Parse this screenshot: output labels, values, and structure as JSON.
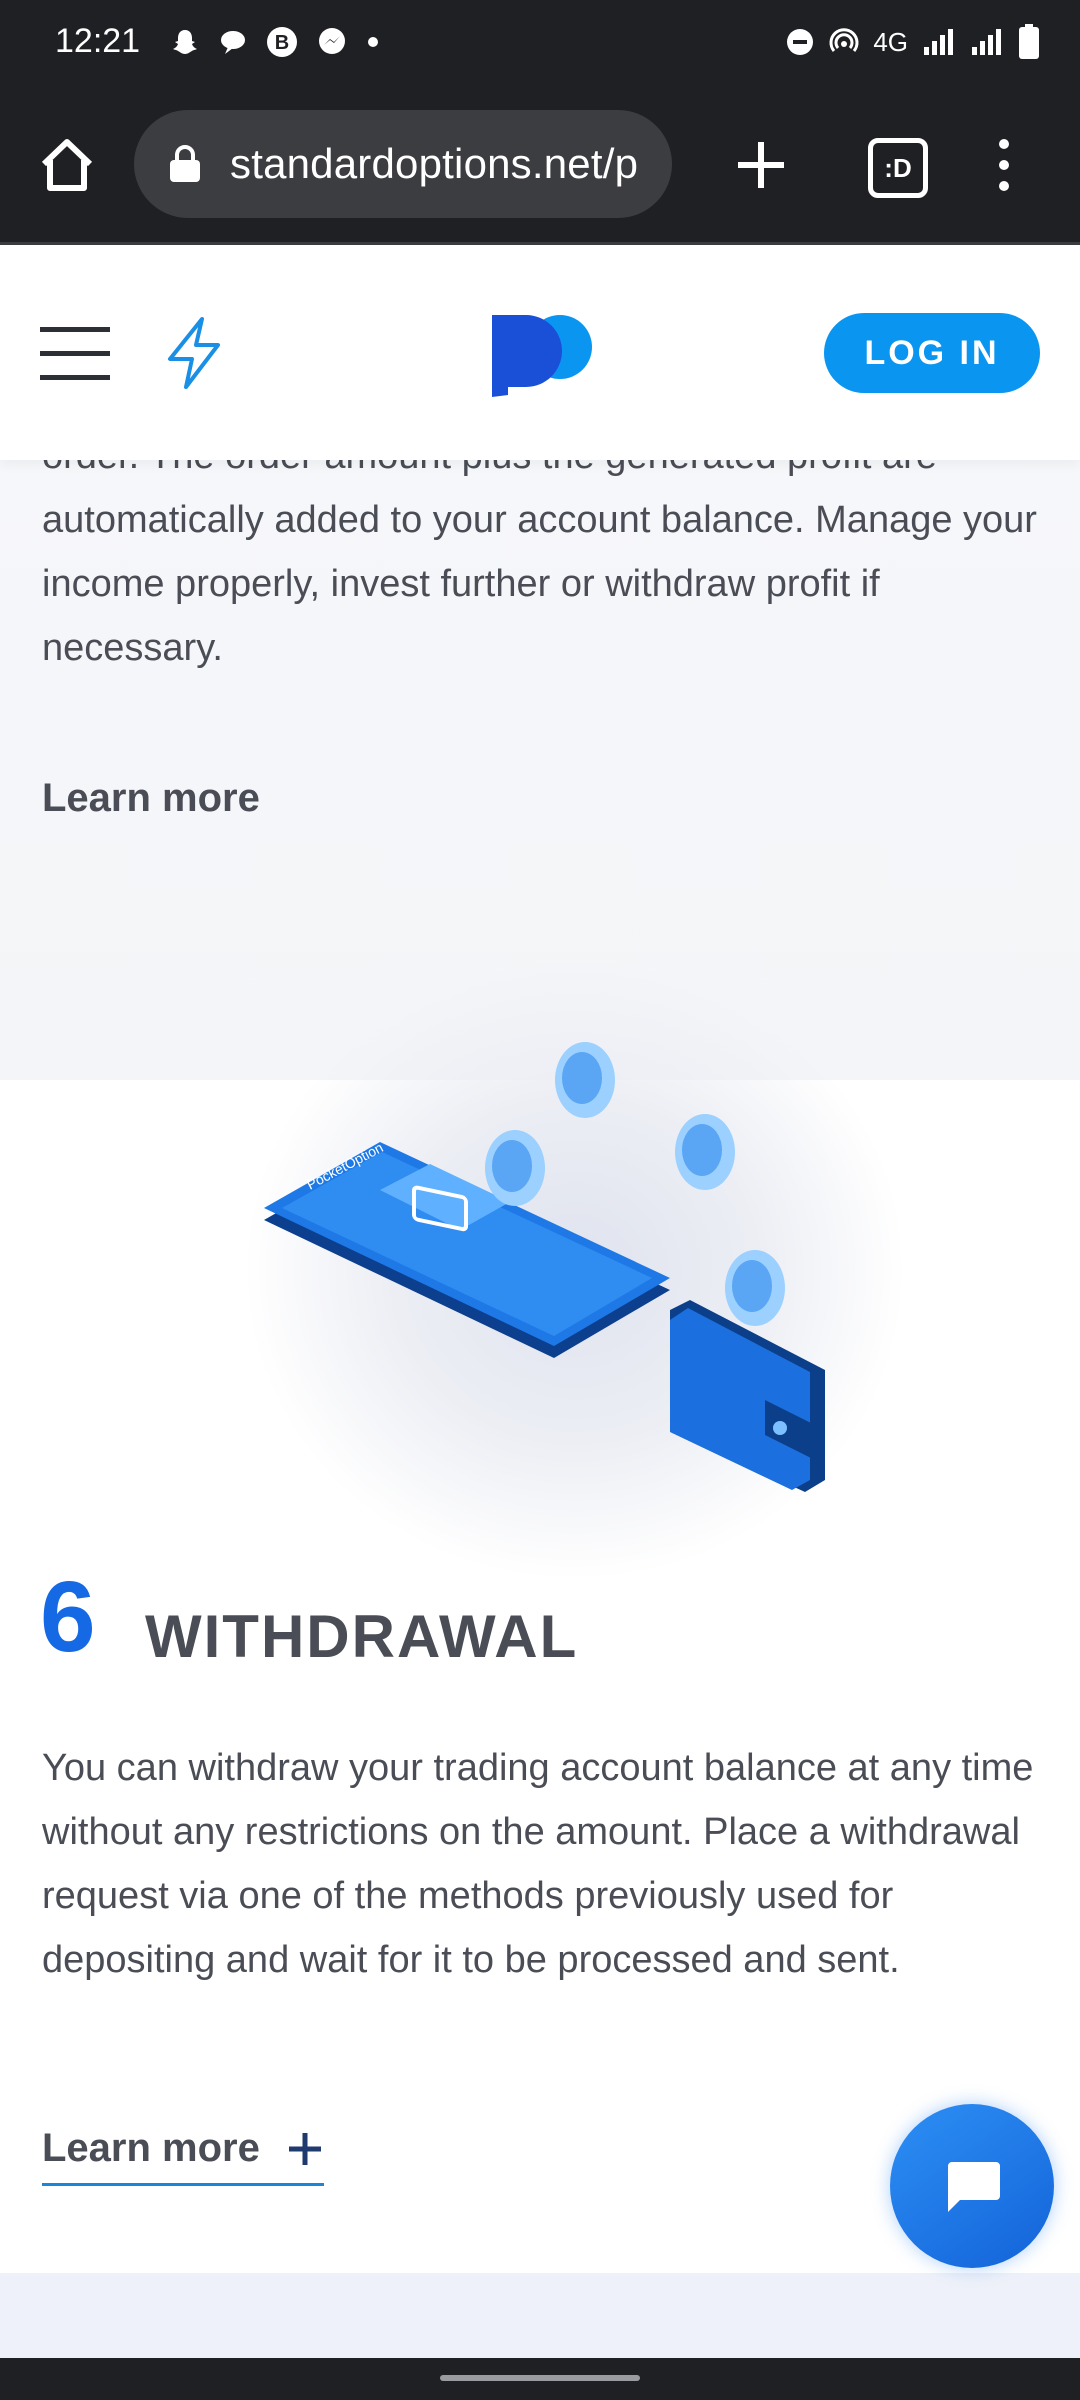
{
  "status_bar": {
    "time": "12:21",
    "left_icons": [
      "snapchat-icon",
      "chat-bubble-icon",
      "b-icon",
      "messenger-icon",
      "dot-icon"
    ],
    "network": "4G",
    "right_icons": [
      "dnd-icon",
      "hotspot-icon",
      "signal-icon",
      "signal-icon",
      "battery-icon"
    ]
  },
  "browser": {
    "url": "standardoptions.net/p",
    "tabs_label": ":D"
  },
  "header": {
    "login_label": "LOG IN"
  },
  "content": {
    "partial_paragraph": "order. The order amount plus the generated profit are automatically added to your account balance. Manage your income properly, invest further or withdraw profit if necessary.",
    "learn_more_1": "Learn more",
    "step_number": "6",
    "step_title": "WITHDRAWAL",
    "step_paragraph": "You can withdraw your trading account balance at any time without any restrictions on the amount. Place a withdrawal request via one of the methods previously used for depositing and wait for it to be processed and sent.",
    "learn_more_2": "Learn more",
    "illustration_phone_brand": "PocketOption"
  },
  "colors": {
    "accent": "#0a96f0",
    "step_number": "#1669e4",
    "chat_button": "#1a73e8"
  }
}
